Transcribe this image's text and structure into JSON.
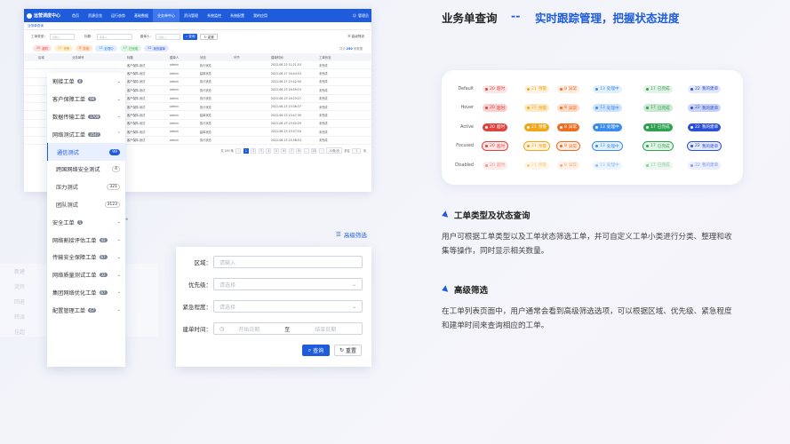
{
  "header": {
    "title": "业务单查询",
    "separator": "--",
    "subtitle": "实时跟踪管理，把握状态进度"
  },
  "app": {
    "logo": "运营调度中心",
    "nav": [
      "首页",
      "资源总览",
      "运行态势",
      "基础数据",
      "业务单中心",
      "资讯管理",
      "系统监控",
      "系统配置",
      "我的应用"
    ],
    "user": "管理员",
    "tab": "业务单查询",
    "filters": {
      "type_label": "工单类型：",
      "type_ph": "请输入",
      "title_label": "标题：",
      "title_ph": "请输入",
      "creator_label": "建单人：",
      "creator_ph": "请输入",
      "query": "查询",
      "reset": "重置",
      "advanced": "高级筛选"
    },
    "chips": [
      {
        "n": "20",
        "t": "超时",
        "bg": "#fde2e1",
        "fg": "#e0443e"
      },
      {
        "n": "21",
        "t": "预警",
        "bg": "#fff1d6",
        "fg": "#e89a10"
      },
      {
        "n": "8",
        "t": "异常",
        "bg": "#ffe4d1",
        "fg": "#e96a1b"
      },
      {
        "n": "13",
        "t": "处理中",
        "bg": "#e0efff",
        "fg": "#2f7be8"
      },
      {
        "n": "17",
        "t": "已完成",
        "bg": "#dff5e5",
        "fg": "#2ea24e"
      },
      {
        "n": "22",
        "t": "我的建单",
        "bg": "#e3e9ff",
        "fg": "#2b4fd6"
      }
    ],
    "summary": "共计",
    "summary_n": "250",
    "summary_tail": "条数据",
    "columns": [
      "区域",
      "业务单号",
      "标题",
      "建单人",
      "状态",
      "环节",
      "建单时间",
      "工单状态"
    ],
    "rows": [
      {
        "title": "客户保障-测试",
        "creator": "admin",
        "status": "执行状态",
        "time": "2022-06-23 11:21:53",
        "state": "未完成"
      },
      {
        "title": "客户保障-测试",
        "creator": "admin",
        "status": "建单状态",
        "time": "2022-06-27 16:44:53",
        "state": "未完成"
      },
      {
        "title": "客户保障-测试",
        "creator": "admin",
        "status": "执行状态",
        "time": "2022-06-27 15:42:50",
        "state": "未完成"
      },
      {
        "title": "客户保障-测试",
        "creator": "admin",
        "status": "执行状态",
        "time": "2022-06-23 16:59:15",
        "state": "未完成"
      },
      {
        "title": "客户保障-测试",
        "creator": "admin",
        "status": "执行状态",
        "time": "2022-06-23 16:23:27",
        "state": "未完成"
      },
      {
        "title": "客户保障-测试",
        "creator": "admin",
        "status": "执行状态",
        "time": "2022-06-23 15:36:37",
        "state": "未完成"
      },
      {
        "title": "客户保障-测试",
        "creator": "admin",
        "status": "建单状态",
        "time": "2022-06-23 15:47:39",
        "state": "未完成"
      },
      {
        "title": "客户保障-测试",
        "creator": "admin",
        "status": "执行状态",
        "time": "2022-06-23 15:40:29",
        "state": "未完成"
      },
      {
        "title": "客户保障-测试",
        "creator": "admin",
        "status": "建单状态",
        "time": "2022-06-23 15:37:16",
        "state": "未完成"
      },
      {
        "title": "客户保障-测试",
        "creator": "admin",
        "status": "执行状态",
        "time": "2022-06-23 15:36:53",
        "state": "未完成"
      }
    ],
    "pager": {
      "total": "共 250 条",
      "pages": [
        "1",
        "2",
        "3",
        "4",
        "5",
        "6",
        "7",
        "8",
        "...",
        "25"
      ],
      "size": "10条/页",
      "goto": "前往",
      "goto_val": "1",
      "goto_tail": "页"
    }
  },
  "dropdown": [
    {
      "label": "割接工单",
      "count": "6",
      "expand": "v"
    },
    {
      "label": "客户保障工单",
      "count": "99",
      "expand": "v"
    },
    {
      "label": "数据传输工单",
      "count": "1709",
      "expand": "v"
    },
    {
      "label": "网络测试工单",
      "count": "3547",
      "expand": "^"
    },
    {
      "label": "通信测试",
      "num": "99",
      "sub": true,
      "sel": true
    },
    {
      "label": "跨国网络安全测试",
      "num": "4",
      "sub": true
    },
    {
      "label": "压力测试",
      "num": "321",
      "sub": true
    },
    {
      "label": "团队测试",
      "num": "3123",
      "sub": true
    },
    {
      "label": "安全工单",
      "count": "5",
      "expand": "v"
    },
    {
      "label": "网络割接评估工单",
      "count": "42",
      "expand": "v"
    },
    {
      "label": "传输安全保障工单",
      "count": "67",
      "expand": "v"
    },
    {
      "label": "网络质量测试工单",
      "count": "32",
      "expand": "v"
    },
    {
      "label": "集团网络优化工单",
      "count": "67",
      "expand": "v"
    },
    {
      "label": "配置管理工单",
      "count": "67",
      "expand": "v"
    }
  ],
  "ghost": [
    "新建",
    "流转",
    "回退",
    "转派",
    "挂起"
  ],
  "form": {
    "advanced_label": "高级筛选",
    "region_label": "区域：",
    "region_ph": "请输入",
    "priority_label": "优先级：",
    "priority_ph": "请选择",
    "urgency_label": "紧急程度：",
    "urgency_ph": "请选择",
    "time_label": "建单时间：",
    "start_ph": "开始日期",
    "to": "至",
    "end_ph": "结束日期",
    "query": "查询",
    "reset": "重置"
  },
  "states": {
    "labels": [
      "Default",
      "Hover",
      "Active",
      "Focused",
      "Disabled"
    ],
    "chips": [
      {
        "n": "20",
        "t": "超时",
        "c": "#e0443e"
      },
      {
        "n": "21",
        "t": "预警",
        "c": "#f0a81a"
      },
      {
        "n": "8",
        "t": "异常",
        "c": "#ee6d1e"
      },
      {
        "n": "13",
        "t": "处理中",
        "c": "#3b8cf0"
      },
      {
        "n": "17",
        "t": "已完成",
        "c": "#2ea24e"
      },
      {
        "n": "22",
        "t": "我的建单",
        "c": "#2b4fd6"
      }
    ]
  },
  "section1": {
    "title": "工单类型及状态查询",
    "body": "用户可根据工单类型以及工单状态筛选工单，并可自定义工单小类进行分类、整理和收集等操作，同时显示相关数量。"
  },
  "section2": {
    "title": "高级筛选",
    "body": "在工单列表页面中，用户通常会看到高级筛选选项，可以根据区域、优先级、紧急程度和建单时间来查询相应的工单。"
  }
}
